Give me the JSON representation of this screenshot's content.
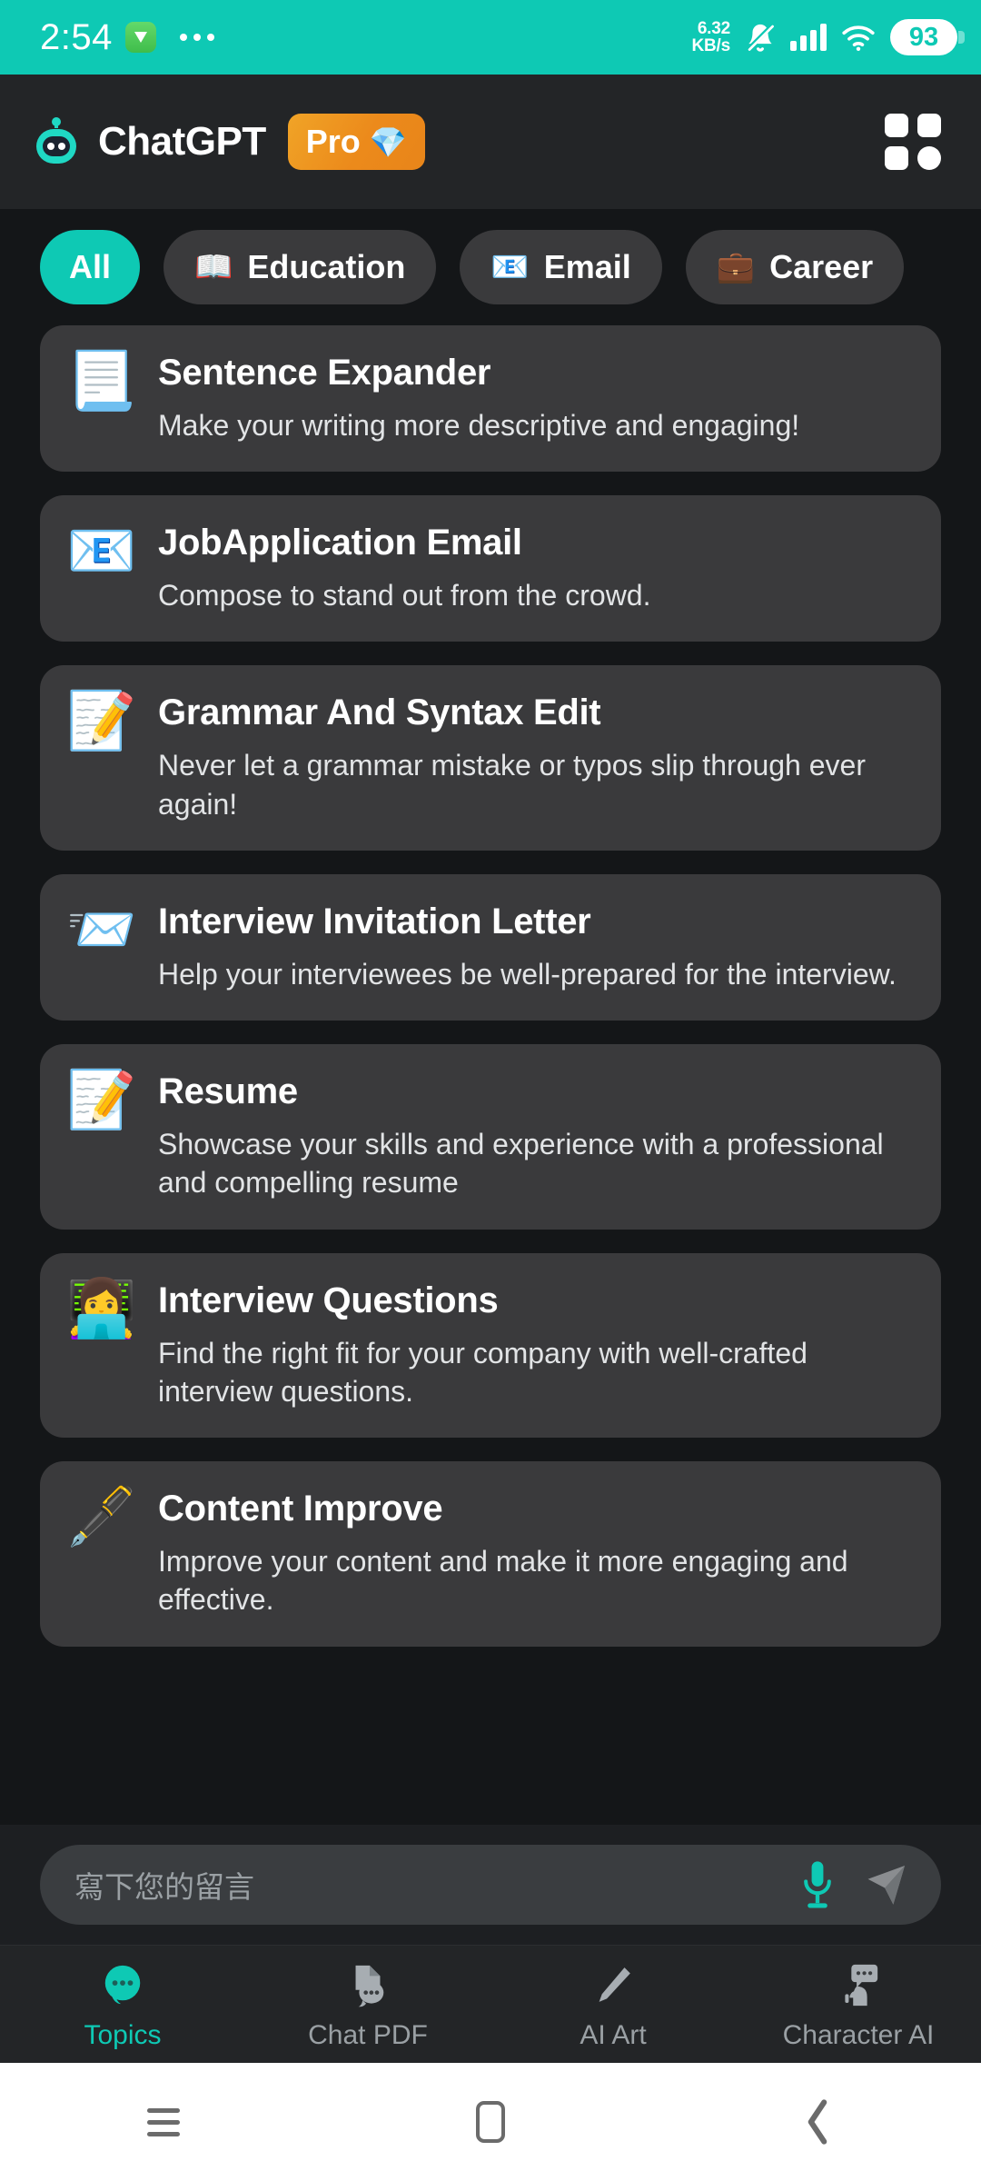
{
  "status_bar": {
    "time": "2:54",
    "download_icon": "download-arrow-icon",
    "overflow_icon": "overflow-dots-icon",
    "net_speed_value": "6.32",
    "net_speed_unit": "KB/s",
    "mute_icon": "bell-muted-icon",
    "signal_icon": "cellular-signal-icon",
    "wifi_icon": "wifi-icon",
    "battery_level": "93",
    "bg_color": "#0ec9b4"
  },
  "header": {
    "logo_icon": "robot-logo-icon",
    "title": "ChatGPT",
    "pro_label": "Pro",
    "pro_gem": "💎",
    "pro_color": "#ec8a1b",
    "grid_icon": "grid-menu-icon"
  },
  "filters": {
    "chips": [
      {
        "label": "All",
        "icon": "",
        "active": true
      },
      {
        "label": "Education",
        "icon": "📖",
        "active": false
      },
      {
        "label": "Email",
        "icon": "📧",
        "active": false
      },
      {
        "label": "Career",
        "icon": "💼",
        "active": false
      }
    ],
    "active_color": "#0ec9b4"
  },
  "prompt_cards": [
    {
      "icon": "📃",
      "icon_name": "page-with-curl-icon",
      "title": "Sentence Expander",
      "desc": "Make your writing more descriptive and engaging!"
    },
    {
      "icon": "📧",
      "icon_name": "email-at-icon",
      "title": "JobApplication Email",
      "desc": "Compose to stand out from the crowd."
    },
    {
      "icon": "📝",
      "icon_name": "pen-and-books-icon",
      "title": "Grammar And Syntax Edit",
      "desc": "Never let a grammar mistake or typos slip through ever again!"
    },
    {
      "icon": "📨",
      "icon_name": "incoming-envelope-icon",
      "title": "Interview Invitation Letter",
      "desc": "Help your interviewees be well-prepared for the interview."
    },
    {
      "icon": "📝",
      "icon_name": "memo-resume-icon",
      "title": "Resume",
      "desc": "Showcase your skills and experience with a professional and compelling resume"
    },
    {
      "icon": "👩‍💻",
      "icon_name": "person-at-computer-icon",
      "title": "Interview Questions",
      "desc": "Find the right fit for your company with well-crafted interview questions."
    },
    {
      "icon": "🖋️",
      "icon_name": "fountain-pen-icon",
      "title": "Content Improve",
      "desc": "Improve your content and make it more engaging and effective."
    }
  ],
  "composer": {
    "placeholder": "寫下您的留言",
    "mic_icon": "microphone-icon",
    "mic_color": "#0ec9b4",
    "send_icon": "send-arrow-icon",
    "send_color": "#8a8d90"
  },
  "bottom_nav": {
    "items": [
      {
        "label": "Topics",
        "icon_name": "chat-bubble-icon",
        "active": true
      },
      {
        "label": "Chat PDF",
        "icon_name": "chat-pdf-icon",
        "active": false
      },
      {
        "label": "AI Art",
        "icon_name": "paintbrush-icon",
        "active": false
      },
      {
        "label": "Character AI",
        "icon_name": "character-ai-icon",
        "active": false
      }
    ],
    "active_color": "#0ec9b4"
  },
  "android_nav": {
    "recents_icon": "recents-menu-icon",
    "home_icon": "home-button-icon",
    "back_icon": "back-chevron-icon"
  }
}
